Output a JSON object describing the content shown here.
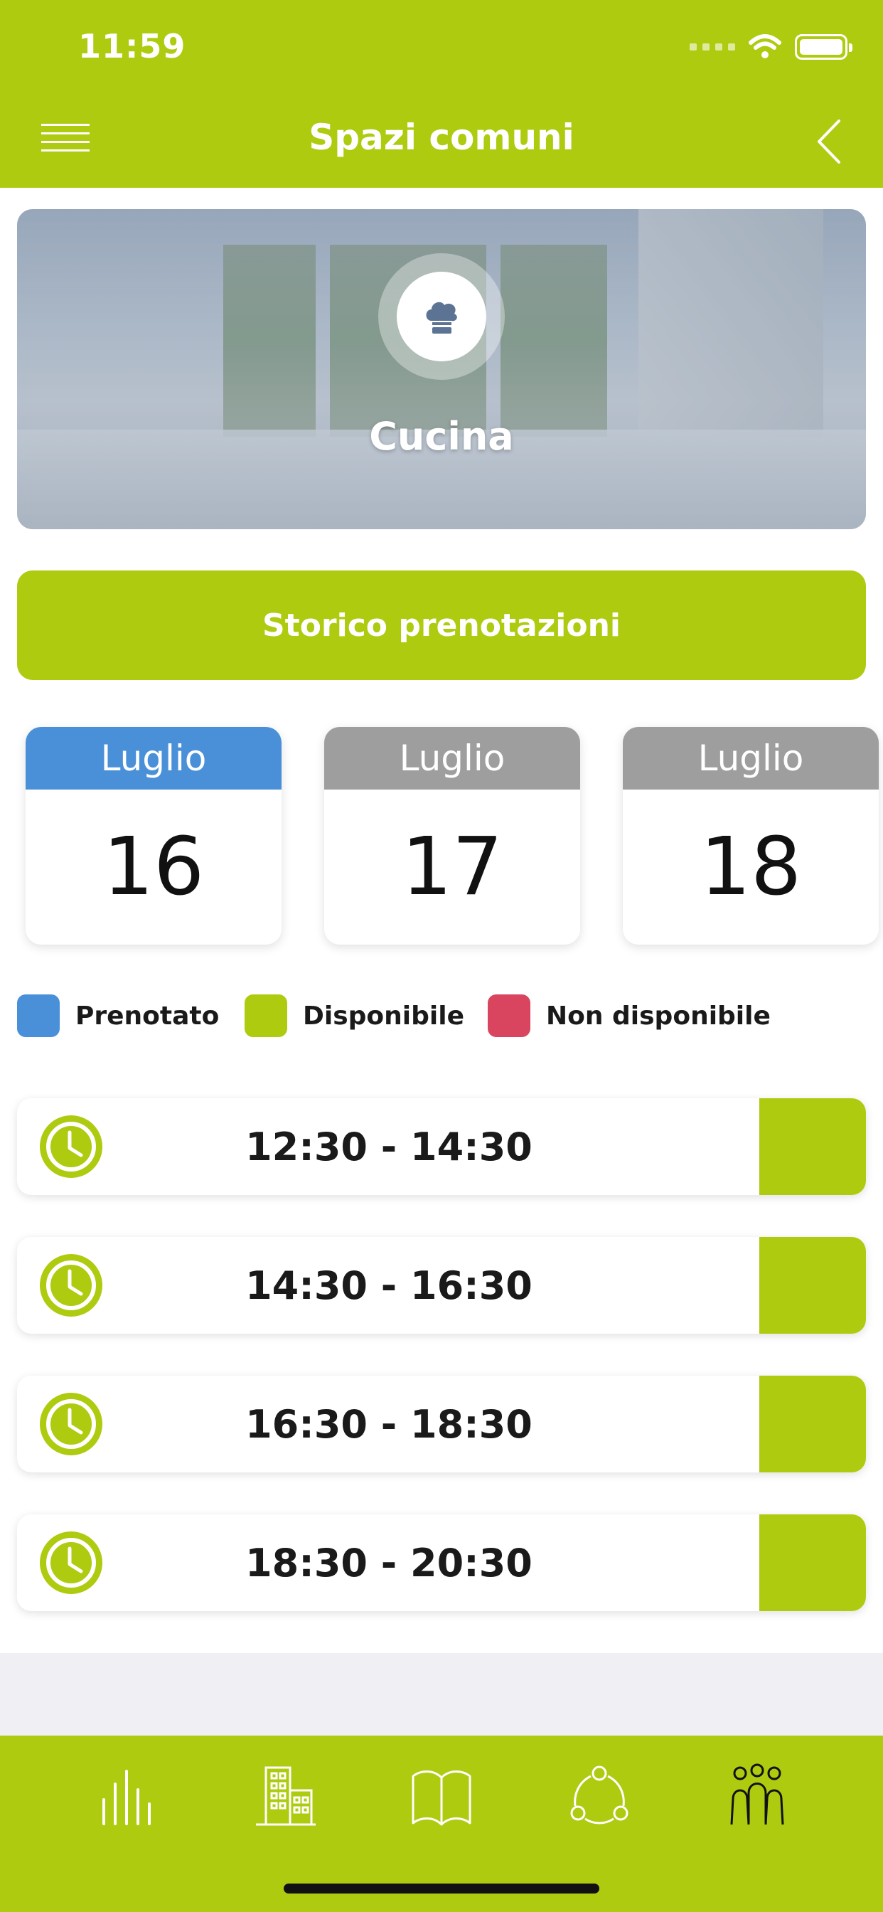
{
  "status_bar": {
    "time": "11:59"
  },
  "header": {
    "title": "Spazi comuni"
  },
  "space": {
    "name": "Cucina",
    "icon": "chef-hat-icon"
  },
  "history_button": {
    "label": "Storico prenotazioni"
  },
  "dates": [
    {
      "month": "Luglio",
      "day": "16",
      "selected": true,
      "header_color": "#4a90d9"
    },
    {
      "month": "Luglio",
      "day": "17",
      "selected": false,
      "header_color": "#9e9e9e"
    },
    {
      "month": "Luglio",
      "day": "18",
      "selected": false,
      "header_color": "#9e9e9e"
    }
  ],
  "legend": [
    {
      "label": "Prenotato",
      "color": "#4a90d9"
    },
    {
      "label": "Disponibile",
      "color": "#aecb10"
    },
    {
      "label": "Non disponibile",
      "color": "#d9455f"
    }
  ],
  "slots": [
    {
      "time": "12:30 - 14:30",
      "status": "Disponibile",
      "status_color": "#aecb10"
    },
    {
      "time": "14:30 - 16:30",
      "status": "Disponibile",
      "status_color": "#aecb10"
    },
    {
      "time": "16:30 - 18:30",
      "status": "Disponibile",
      "status_color": "#aecb10"
    },
    {
      "time": "18:30 - 20:30",
      "status": "Disponibile",
      "status_color": "#aecb10"
    }
  ],
  "tab_bar": {
    "items": [
      {
        "icon": "bar-chart-icon"
      },
      {
        "icon": "building-icon"
      },
      {
        "icon": "book-icon"
      },
      {
        "icon": "share-network-icon"
      },
      {
        "icon": "people-icon"
      }
    ]
  },
  "colors": {
    "brand": "#aecb10",
    "selected": "#4a90d9",
    "unavailable": "#d9455f"
  }
}
